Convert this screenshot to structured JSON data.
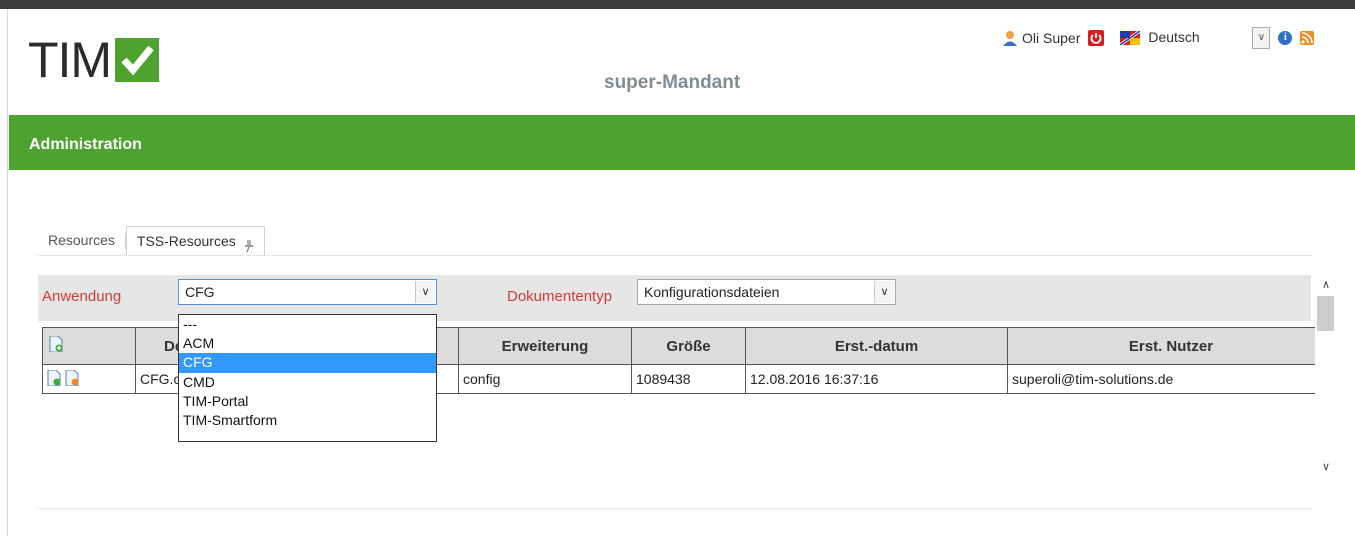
{
  "logo": {
    "text": "TIM"
  },
  "header": {
    "tenant": "super-Mandant",
    "user_name": "Oli Super",
    "language": "Deutsch"
  },
  "adminbar": {
    "title": "Administration"
  },
  "tabs": [
    {
      "label": "Resources"
    },
    {
      "label": "TSS-Resources"
    }
  ],
  "filters": {
    "anwendung_label": "Anwendung",
    "anwendung_value": "CFG",
    "dokumententyp_label": "Dokumententyp",
    "dokumententyp_value": "Konfigurationsdateien"
  },
  "dropdown_options": [
    "---",
    "ACM",
    "CFG",
    "CMD",
    "TIM-Portal",
    "TIM-Smartform"
  ],
  "table": {
    "columns": [
      "De",
      "Erweiterung",
      "Größe",
      "Erst.-datum",
      "Erst. Nutzer"
    ],
    "rows": [
      {
        "name": "CFG.c",
        "extension": "config",
        "size": "1089438",
        "date": "12.08.2016 16:37:16",
        "user": "superoli@tim-solutions.de"
      }
    ]
  },
  "colors": {
    "accent": "#4ea22f",
    "label_red": "#d23b3b",
    "selection": "#3399ff"
  }
}
